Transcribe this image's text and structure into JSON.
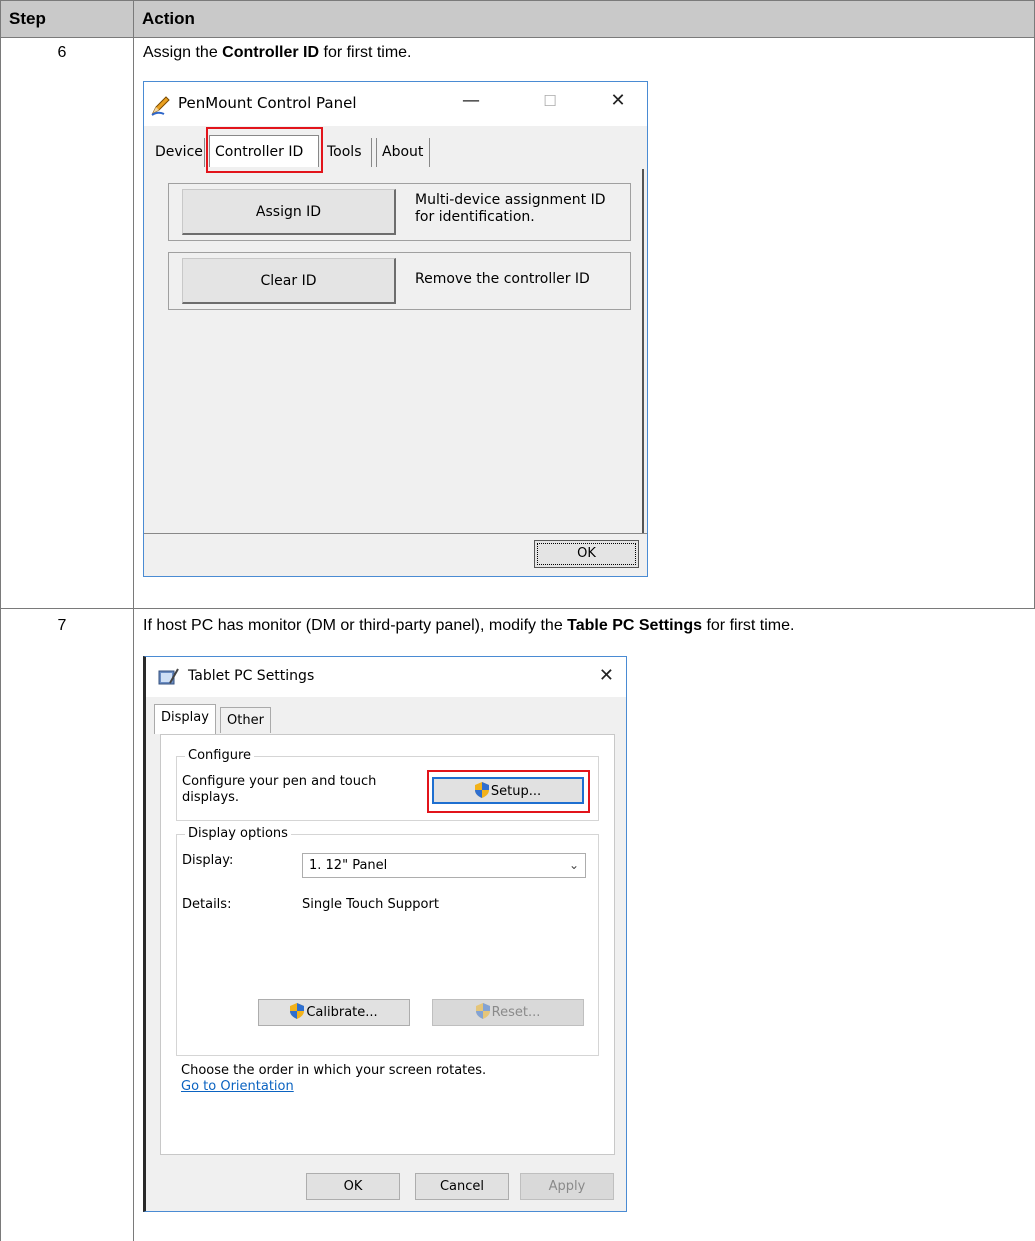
{
  "table": {
    "header_step": "Step",
    "header_action": "Action"
  },
  "step6": {
    "number": "6",
    "text_before": "Assign the ",
    "text_bold": "Controller ID",
    "text_after": " for first time."
  },
  "step7": {
    "number": "7",
    "text_before": "If host PC has monitor (DM or third-party panel), modify the ",
    "text_bold": "Table PC Settings",
    "text_after": " for first time."
  },
  "penmount": {
    "title": "PenMount Control Panel",
    "minimize": "—",
    "maximize": "☐",
    "close": "✕",
    "tabs": [
      "Device",
      "Controller ID",
      "Tools",
      "About"
    ],
    "assign_button": "Assign ID",
    "assign_desc_1": "Multi-device assignment ID",
    "assign_desc_2": "for identification.",
    "clear_button": "Clear ID",
    "clear_desc": "Remove the controller ID",
    "ok_button": "OK",
    "highlight_color": "#e2141b"
  },
  "tablet": {
    "title": "Tablet PC Settings",
    "close": "✕",
    "tabs": [
      "Display",
      "Other"
    ],
    "configure_legend": "Configure",
    "configure_text_1": "Configure your pen and touch",
    "configure_text_2": "displays.",
    "setup_button": "Setup...",
    "display_options_legend": "Display options",
    "display_label": "Display:",
    "display_value": "1. 12\" Panel",
    "details_label": "Details:",
    "details_value": "Single Touch Support",
    "calibrate_button": "Calibrate...",
    "reset_button": "Reset...",
    "orientation_text": "Choose the order in which your screen rotates.",
    "orientation_link": "Go to Orientation",
    "ok_button": "OK",
    "cancel_button": "Cancel",
    "apply_button": "Apply"
  }
}
